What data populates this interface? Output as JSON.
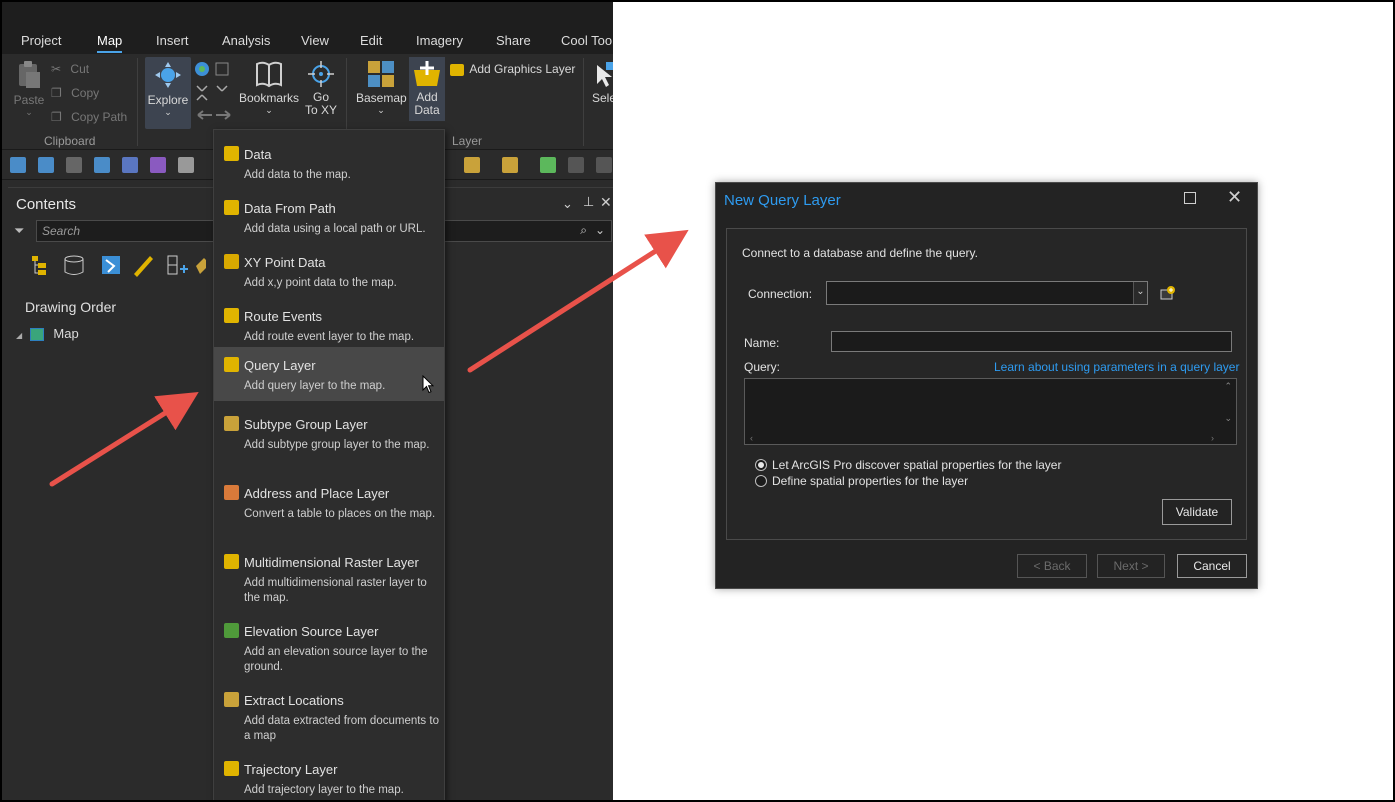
{
  "ribbon_tabs": [
    "Project",
    "Map",
    "Insert",
    "Analysis",
    "View",
    "Edit",
    "Imagery",
    "Share",
    "Cool Too"
  ],
  "active_tab": "Map",
  "clipboard": {
    "paste": "Paste",
    "cut": "Cut",
    "copy": "Copy",
    "copy_path": "Copy Path",
    "group": "Clipboard"
  },
  "navigate": {
    "explore": "Explore",
    "bookmarks": "Bookmarks",
    "go_to_xy": "Go\nTo XY"
  },
  "layer_group": {
    "basemap": "Basemap",
    "add_data": "Add\nData",
    "add_graphics_layer": "Add Graphics Layer",
    "label": "Layer",
    "select": "Sele"
  },
  "contents": {
    "title": "Contents",
    "search_placeholder": "Search",
    "drawing_order": "Drawing Order",
    "map_node": "Map"
  },
  "add_data_menu": [
    {
      "title": "Data",
      "desc": "Add data to the map.",
      "icon": "data-icon"
    },
    {
      "title": "Data From Path",
      "desc": "Add data using a local path or URL.",
      "icon": "data-from-path-icon"
    },
    {
      "title": "XY Point Data",
      "desc": "Add x,y point data to the map.",
      "icon": "xy-point-icon"
    },
    {
      "title": "Route Events",
      "desc": "Add route event layer to the map.",
      "icon": "route-events-icon"
    },
    {
      "title": "Query Layer",
      "desc": "Add query layer to the map.",
      "icon": "query-layer-icon"
    },
    {
      "title": "Subtype Group Layer",
      "desc": "Add subtype group layer to the map.",
      "icon": "subtype-group-icon"
    },
    {
      "title": "Address and Place Layer",
      "desc": "Convert a table to places on the map.",
      "icon": "address-place-icon"
    },
    {
      "title": "Multidimensional Raster Layer",
      "desc": "Add multidimensional raster layer to the map.",
      "icon": "multidimensional-raster-icon"
    },
    {
      "title": "Elevation Source Layer",
      "desc": "Add an elevation source layer to the ground.",
      "icon": "elevation-source-icon"
    },
    {
      "title": "Extract Locations",
      "desc": "Add data extracted from documents to a map",
      "icon": "extract-locations-icon"
    },
    {
      "title": "Trajectory Layer",
      "desc": "Add trajectory layer to the map.",
      "icon": "trajectory-icon"
    }
  ],
  "highlighted_menu_item": "Query Layer",
  "dialog": {
    "title": "New Query Layer",
    "intro": "Connect to a database and define the query.",
    "connection_label": "Connection:",
    "connection_value": "",
    "name_label": "Name:",
    "name_value": "",
    "query_label": "Query:",
    "query_value": "",
    "help_link": "Learn about using parameters in a query layer",
    "radio_discover": "Let ArcGIS Pro discover spatial properties for the layer",
    "radio_define": "Define spatial properties for the layer",
    "validate": "Validate",
    "back": "< Back",
    "next": "Next >",
    "cancel": "Cancel"
  },
  "colors": {
    "app_bg": "#2b2b2b",
    "accent_blue": "#2e9bf0",
    "arrow_red": "#e8524a",
    "menu_highlight": "#484848"
  }
}
